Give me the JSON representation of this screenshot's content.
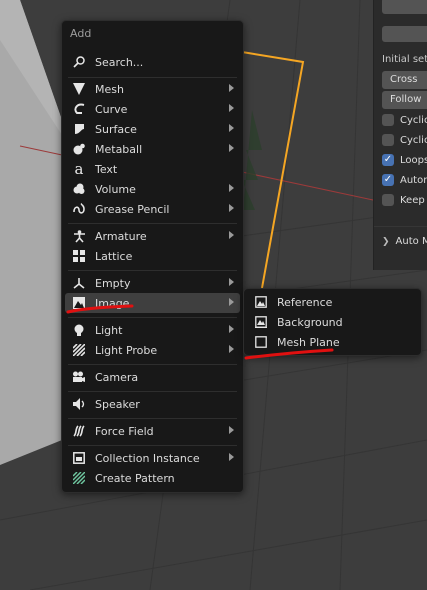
{
  "add_menu": {
    "title": "Add",
    "search": "Search...",
    "items": [
      {
        "label": "Mesh",
        "icon": "mesh-cone-icon",
        "submenu": true
      },
      {
        "label": "Curve",
        "icon": "curve-icon",
        "submenu": true
      },
      {
        "label": "Surface",
        "icon": "surface-icon",
        "submenu": true
      },
      {
        "label": "Metaball",
        "icon": "metaball-icon",
        "submenu": true
      },
      {
        "label": "Text",
        "icon": "text-icon",
        "submenu": false
      },
      {
        "label": "Volume",
        "icon": "volume-icon",
        "submenu": true
      },
      {
        "label": "Grease Pencil",
        "icon": "grease-pencil-icon",
        "submenu": true
      },
      {
        "label": "Armature",
        "icon": "armature-icon",
        "submenu": true
      },
      {
        "label": "Lattice",
        "icon": "lattice-icon",
        "submenu": false
      },
      {
        "label": "Empty",
        "icon": "empty-icon",
        "submenu": true
      },
      {
        "label": "Image",
        "icon": "image-icon",
        "submenu": true,
        "active": true
      },
      {
        "label": "Light",
        "icon": "light-icon",
        "submenu": true
      },
      {
        "label": "Light Probe",
        "icon": "light-probe-icon",
        "submenu": true
      },
      {
        "label": "Camera",
        "icon": "camera-icon",
        "submenu": false
      },
      {
        "label": "Speaker",
        "icon": "speaker-icon",
        "submenu": false
      },
      {
        "label": "Force Field",
        "icon": "force-field-icon",
        "submenu": true
      },
      {
        "label": "Collection Instance",
        "icon": "collection-icon",
        "submenu": true
      },
      {
        "label": "Create Pattern",
        "icon": "pattern-icon",
        "submenu": false
      }
    ]
  },
  "image_submenu": {
    "items": [
      {
        "label": "Reference",
        "icon": "image-reference-icon"
      },
      {
        "label": "Background",
        "icon": "image-background-icon"
      },
      {
        "label": "Mesh Plane",
        "icon": "mesh-plane-icon"
      }
    ]
  },
  "properties_panel": {
    "initial_label": "Initial set",
    "option_1": "Cross",
    "option_2": "Follow",
    "checkboxes": [
      {
        "label": "Cyclic",
        "checked": false
      },
      {
        "label": "Cyclic",
        "checked": false
      },
      {
        "label": "Loops",
        "checked": true
      },
      {
        "label": "Autom",
        "checked": true
      },
      {
        "label": "Keep",
        "checked": false
      }
    ],
    "automask": "Auto M"
  },
  "colors": {
    "accent_orange": "#f5a623",
    "annotation_red": "#e01010",
    "checkbox_blue": "#4772b3"
  }
}
